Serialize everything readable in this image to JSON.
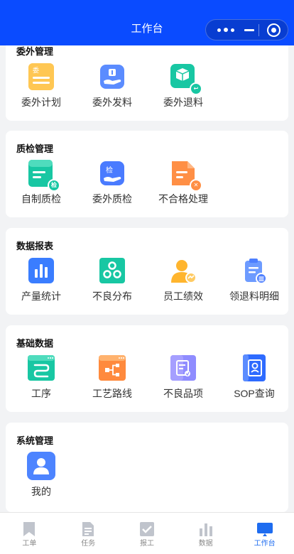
{
  "header": {
    "title": "工作台"
  },
  "sections": [
    {
      "title": "委外管理",
      "items": [
        {
          "label": "委外计划",
          "icon": "outsource-plan-icon",
          "badge": ""
        },
        {
          "label": "委外发料",
          "icon": "outsource-issue-icon",
          "badge": ""
        },
        {
          "label": "委外退料",
          "icon": "outsource-return-icon",
          "badge": ""
        }
      ]
    },
    {
      "title": "质检管理",
      "items": [
        {
          "label": "自制质检",
          "icon": "self-inspection-icon",
          "badge": "检"
        },
        {
          "label": "委外质检",
          "icon": "outsource-inspection-icon",
          "badge": "检"
        },
        {
          "label": "不合格处理",
          "icon": "nonconforming-icon",
          "badge": ""
        }
      ]
    },
    {
      "title": "数据报表",
      "items": [
        {
          "label": "产量统计",
          "icon": "bar-chart-icon"
        },
        {
          "label": "不良分布",
          "icon": "defect-distribution-icon"
        },
        {
          "label": "员工绩效",
          "icon": "employee-performance-icon"
        },
        {
          "label": "领退料明细",
          "icon": "material-detail-icon"
        }
      ]
    },
    {
      "title": "基础数据",
      "items": [
        {
          "label": "工序",
          "icon": "process-icon"
        },
        {
          "label": "工艺路线",
          "icon": "process-route-icon"
        },
        {
          "label": "不良品项",
          "icon": "defect-item-icon"
        },
        {
          "label": "SOP查询",
          "icon": "sop-book-icon"
        }
      ]
    },
    {
      "title": "系统管理",
      "items": [
        {
          "label": "我的",
          "icon": "user-icon"
        }
      ]
    }
  ],
  "tabbar": [
    {
      "label": "工单",
      "icon": "bookmark-icon",
      "active": false
    },
    {
      "label": "任务",
      "icon": "document-icon",
      "active": false
    },
    {
      "label": "报工",
      "icon": "checkbox-icon",
      "active": false
    },
    {
      "label": "数据",
      "icon": "chart-icon",
      "active": false
    },
    {
      "label": "工作台",
      "icon": "monitor-icon",
      "active": true
    }
  ],
  "colors": {
    "brand_blue": "#0a4bff",
    "tab_active": "#1e6cf0",
    "tab_inactive": "#8a8a8a"
  }
}
